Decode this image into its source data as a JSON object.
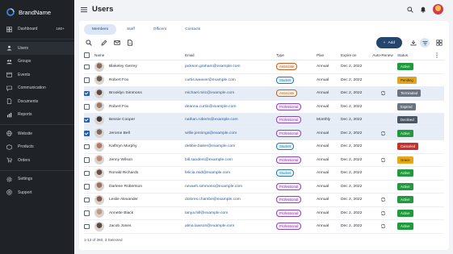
{
  "brand": {
    "name": "BrandName"
  },
  "sidebar": {
    "groups": [
      [
        {
          "label": "Dashboard",
          "icon": "dashboard-icon",
          "count": "180+"
        }
      ],
      [
        {
          "label": "Users",
          "icon": "users-icon",
          "active": true
        },
        {
          "label": "Groups",
          "icon": "groups-icon"
        },
        {
          "label": "Events",
          "icon": "events-icon"
        },
        {
          "label": "Communication",
          "icon": "communication-icon"
        },
        {
          "label": "Documents",
          "icon": "documents-icon"
        },
        {
          "label": "Reports",
          "icon": "reports-icon"
        }
      ],
      [
        {
          "label": "Website",
          "icon": "website-icon"
        },
        {
          "label": "Products",
          "icon": "products-icon"
        },
        {
          "label": "Orders",
          "icon": "orders-icon"
        }
      ],
      [
        {
          "label": "Settings",
          "icon": "settings-icon"
        },
        {
          "label": "Support",
          "icon": "support-icon"
        }
      ]
    ]
  },
  "header": {
    "title": "Users"
  },
  "tabs": [
    {
      "label": "Members",
      "active": true
    },
    {
      "label": "Staff"
    },
    {
      "label": "Officers"
    },
    {
      "label": "Contacts"
    }
  ],
  "toolbar": {
    "add_label": "Add"
  },
  "table": {
    "headers": {
      "name": "Name",
      "email": "Email",
      "type": "Type",
      "plan": "Plan",
      "expire": "Expire on",
      "auto": "Auto-Renew",
      "status": "Status"
    },
    "rows": [
      {
        "name": "Blakeley Gerrey",
        "email": "jackson.graham@example.com",
        "type": "Associate",
        "plan": "Annual",
        "expire": "Dec 2, 2022",
        "auto": false,
        "status": "Active",
        "checked": false,
        "avatar": "#8a6a5a"
      },
      {
        "name": "Robert Fox",
        "email": "curtis.weaver@example.com",
        "type": "Student",
        "plan": "Annual",
        "expire": "Dec 2, 2022",
        "auto": false,
        "status": "Pending",
        "checked": false,
        "avatar": "#6b5a52"
      },
      {
        "name": "Brooklyn Simmons",
        "email": "michael.mitc@example.com",
        "type": "Associate",
        "plan": "Annual",
        "expire": "Dec 2, 2022",
        "auto": true,
        "status": "Terminated",
        "checked": true,
        "avatar": "#5b4a44"
      },
      {
        "name": "Robert Fox",
        "email": "deanna.curtis@example.com",
        "type": "Professional",
        "plan": "Annual",
        "expire": "Dec 2, 2022",
        "auto": false,
        "status": "Expired",
        "checked": false,
        "avatar": "#9a7a66"
      },
      {
        "name": "Bessie Cooper",
        "email": "nathan.roberts@example.com",
        "type": "Professional",
        "plan": "Monthly",
        "expire": "Dec 2, 2022",
        "auto": false,
        "status": "Declined",
        "checked": true,
        "avatar": "#3e3a3a"
      },
      {
        "name": "Jerome Bell",
        "email": "willie.jennings@example.com",
        "type": "Professional",
        "plan": "Annual",
        "expire": "Dec 2, 2022",
        "auto": true,
        "status": "Active",
        "checked": true,
        "avatar": "#7a6a5f"
      },
      {
        "name": "Kathryn Murphy",
        "email": "debbie.baker@example.com",
        "type": "Student",
        "plan": "Annual",
        "expire": "Dec 2, 2022",
        "auto": false,
        "status": "Canceled",
        "checked": false,
        "avatar": "#b07a68"
      },
      {
        "name": "Jenny Wilson",
        "email": "bill.sanders@example.com",
        "type": "Professional",
        "plan": "Annual",
        "expire": "Dec 2, 2022",
        "auto": true,
        "status": "Grace",
        "checked": false,
        "avatar": "#c08a7a"
      },
      {
        "name": "Ronald Richards",
        "email": "felicia.reid@example.com",
        "type": "Student",
        "plan": "Annual",
        "expire": "Dec 2, 2022",
        "auto": false,
        "status": "Active",
        "checked": false,
        "avatar": "#6a5046"
      },
      {
        "name": "Darlene Robertson",
        "email": "nevaeh.simmons@example.com",
        "type": "Professional",
        "plan": "Annual",
        "expire": "Dec 2, 2022",
        "auto": false,
        "status": "Active",
        "checked": false,
        "avatar": "#a07060"
      },
      {
        "name": "Leslie Alexander",
        "email": "dolores.chambe@example.com",
        "type": "Professional",
        "plan": "Annual",
        "expire": "Dec 2, 2022",
        "auto": true,
        "status": "Active",
        "checked": false,
        "avatar": "#8a5a50"
      },
      {
        "name": "Annette Black",
        "email": "tanya.hill@example.com",
        "type": "Professional",
        "plan": "Annual",
        "expire": "Dec 2, 2022",
        "auto": true,
        "status": "Active",
        "checked": false,
        "avatar": "#c09a88"
      },
      {
        "name": "Jacob Jones",
        "email": "alma.lawson@example.com",
        "type": "Professional",
        "plan": "Annual",
        "expire": "Dec 2, 2022",
        "auto": true,
        "status": "Active",
        "checked": false,
        "avatar": "#5a4a42"
      }
    ]
  },
  "footer": {
    "summary": "1-13 of 360, 3 Selected"
  },
  "colors": {
    "sidebar_bg": "#1f2327",
    "add_button": "#23456e",
    "type": {
      "Associate": {
        "fg": "#c0642a",
        "bg": "#fbeee2"
      },
      "Student": {
        "fg": "#2a7fa0",
        "bg": "#e2f2f8"
      },
      "Professional": {
        "fg": "#8a4aa8",
        "bg": "#f2e8f8"
      }
    },
    "status": {
      "Active": "#1f9a3c",
      "Pending": "#e0a51a",
      "Terminated": "#6b7280",
      "Expired": "#6b7280",
      "Declined": "#4b5563",
      "Canceled": "#c8302e",
      "Grace": "#e6a817"
    }
  }
}
